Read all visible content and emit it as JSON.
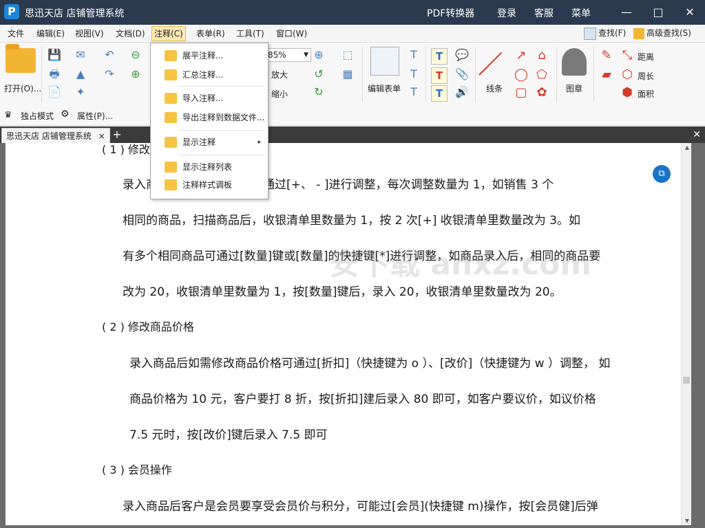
{
  "app": {
    "title": "思迅天店 店铺管理系统",
    "logo": "P",
    "title_links": [
      "PDF转换器",
      "登录",
      "客服",
      "菜单"
    ]
  },
  "menubar": {
    "items": [
      "文件",
      "编辑(E)",
      "视图(V)",
      "文档(D)",
      "注释(C)",
      "表单(R)",
      "工具(T)",
      "窗口(W)"
    ],
    "active_index": 4,
    "find": "查找(F)",
    "advanced_find": "高级查找(S)"
  },
  "ribbon": {
    "open_label": "打开(O)...",
    "zoom_value": "85%",
    "zoom_in_label": "放大",
    "zoom_out_label": "缩小",
    "edit_form_label": "编辑表单",
    "lines_label": "线条",
    "stamp_label": "图章",
    "distance_label": "距离",
    "perimeter_label": "周长",
    "area_label": "面积",
    "exclusive_mode_label": "独占模式",
    "properties_label": "属性(P)..."
  },
  "tabs": {
    "doc_tab": "思迅天店 店铺管理系统",
    "close_glyph": "×",
    "add_glyph": "+"
  },
  "dropdown": {
    "items": [
      {
        "label": "展平注释..."
      },
      {
        "label": "汇总注释..."
      },
      {
        "label": "导入注释..."
      },
      {
        "label": "导出注释到数据文件..."
      },
      {
        "label": "显示注释",
        "submenu": "▸"
      },
      {
        "label": "显示注释列表"
      },
      {
        "label": "注释样式调板"
      }
    ]
  },
  "document": {
    "heading1_partial": "( 1 ) 修改",
    "p1_line1": "录入商品后如需修改数量可通过[+、 - ]进行调整，每次调整数量为 1，如销售 3 个",
    "p1_line2": "相同的商品，扫描商品后，收银清单里数量为 1，按 2 次[+]  收银清单里数量改为 3。如",
    "p1_line3": "有多个相同商品可通过[数量]键或[数量]的快捷键[*]进行调整，如商品录入后，相同的商品要",
    "p1_line4": "改为 20，收银清单里数量为 1，按[数量]键后，录入 20，收银清单里数量改为 20。",
    "heading2": "( 2 ) 修改商品价格",
    "p2_line1": "录入商品后如需修改商品价格可通过[折扣]（快捷键为 o ）、[改价]（快捷键为 w ）调整，  如",
    "p2_line2": "商品价格为 10 元，客户要打 8 折，按[折扣]建后录入 80 即可，如客户要议价，如议价格",
    "p2_line3": "7.5 元时，按[改价]键后录入 7.5 即可",
    "heading3": "( 3 ) 会员操作",
    "p3_line1": "录入商品后客户是会员要享受会员价与积分，可能过[会员](快捷键 m)操作，按[会员健]后弹",
    "watermark": "安下载 anxz.com"
  }
}
